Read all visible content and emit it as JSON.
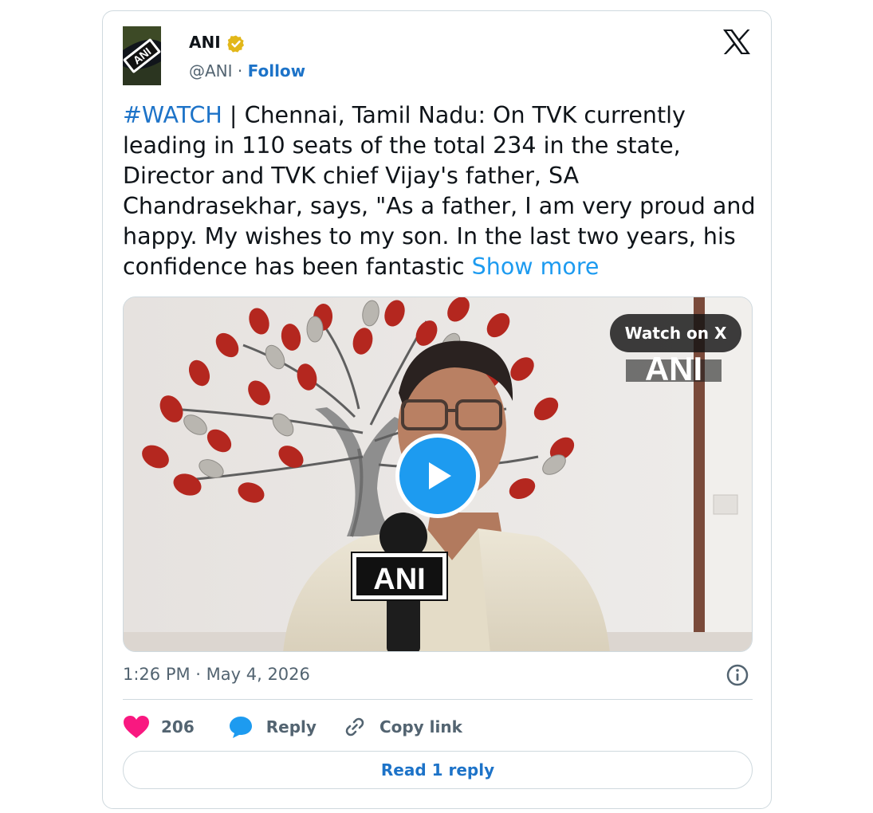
{
  "author": {
    "name": "ANI",
    "handle": "@ANI",
    "separator": "·",
    "follow_label": "Follow",
    "avatar_text": "ANI",
    "verified_icon": "verified-badge-icon"
  },
  "tweet": {
    "hashtag": "#WATCH",
    "body": " | Chennai, Tamil Nadu: On TVK currently leading in 110 seats of the total 234 in the state, Director and TVK chief Vijay's father, SA Chandrasekhar, says, \"As a father, I am very proud and happy. My wishes to my son. In the last two years, his confidence has been fantastic ",
    "show_more": "Show more"
  },
  "media": {
    "watch_label": "Watch on X",
    "watermark": "ANI",
    "mic_label": "ANI",
    "play_icon": "play-icon"
  },
  "meta": {
    "timestamp": "1:26 PM · May 4, 2026"
  },
  "actions": {
    "likes": "206",
    "reply_label": "Reply",
    "copy_label": "Copy link"
  },
  "read_replies_label": "Read 1 reply",
  "colors": {
    "link": "#1d73c8",
    "show_more": "#1d9bf0",
    "like": "#f91880",
    "reply": "#1d9bf0",
    "muted": "#536471",
    "border": "#cfd9de"
  }
}
